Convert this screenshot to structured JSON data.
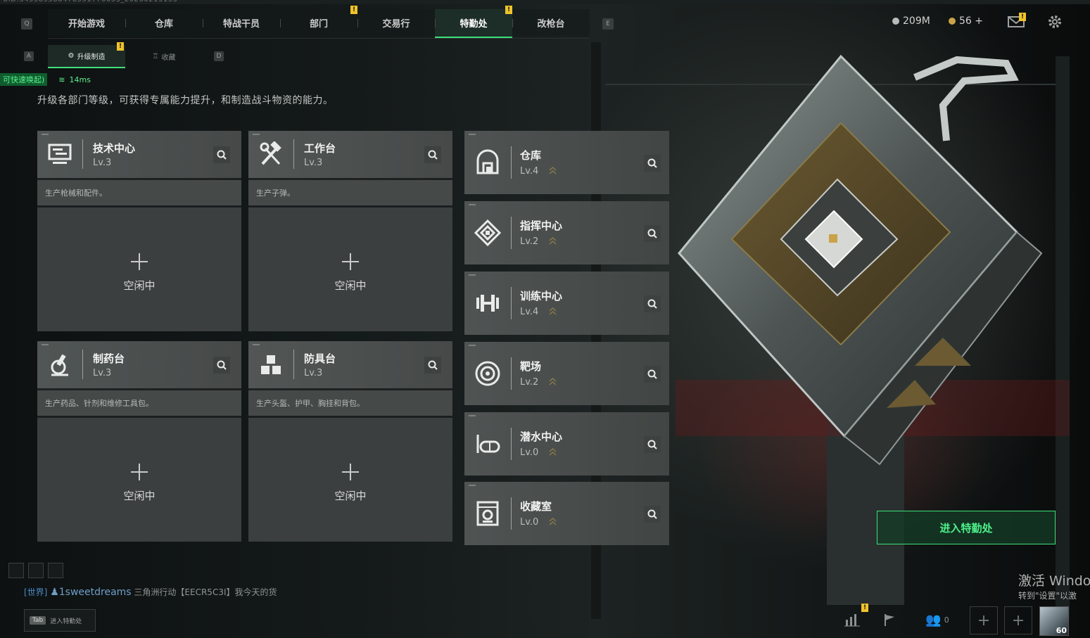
{
  "top_id": "UID:345589588478551770053_20260215155",
  "nav": {
    "left_key": "Q",
    "right_key": "E",
    "tabs": [
      {
        "label": "开始游戏",
        "badge": false
      },
      {
        "label": "仓库",
        "badge": false
      },
      {
        "label": "特战干员",
        "badge": false
      },
      {
        "label": "部门",
        "badge": true
      },
      {
        "label": "交易行",
        "badge": false
      },
      {
        "label": "特勤处",
        "badge": true,
        "active": true
      },
      {
        "label": "改枪台",
        "badge": false
      }
    ]
  },
  "currency": {
    "silver": "209M",
    "gold": "56 +"
  },
  "subnav": {
    "left_key": "A",
    "right_key": "D",
    "tabs": [
      {
        "label": "升级制造",
        "active": true,
        "badge": true
      },
      {
        "label": "收藏",
        "active": false
      }
    ]
  },
  "net": {
    "quick": "可快速唤起)",
    "ping": "14ms"
  },
  "description": "升级各部门等级，可获得专属能力提升，和制造战斗物资的能力。",
  "production": [
    {
      "name": "技术中心",
      "level": "Lv.3",
      "desc": "生产枪械和配件。",
      "status": "空闲中",
      "icon": "monitor-icon"
    },
    {
      "name": "工作台",
      "level": "Lv.3",
      "desc": "生产子弹。",
      "status": "空闲中",
      "icon": "hammer-wrench-icon"
    },
    {
      "name": "制药台",
      "level": "Lv.3",
      "desc": "生产药品、针剂和维修工具包。",
      "status": "空闲中",
      "icon": "microscope-icon"
    },
    {
      "name": "防具台",
      "level": "Lv.3",
      "desc": "生产头盔、护甲、胸挂和背包。",
      "status": "空闲中",
      "icon": "armor-icon"
    }
  ],
  "facilities": [
    {
      "name": "仓库",
      "level": "Lv.4",
      "icon": "warehouse-icon"
    },
    {
      "name": "指挥中心",
      "level": "Lv.2",
      "icon": "command-icon"
    },
    {
      "name": "训练中心",
      "level": "Lv.4",
      "icon": "dumbbell-icon"
    },
    {
      "name": "靶场",
      "level": "Lv.2",
      "icon": "target-icon"
    },
    {
      "name": "潜水中心",
      "level": "Lv.0",
      "icon": "diving-mask-icon"
    },
    {
      "name": "收藏室",
      "level": "Lv.0",
      "icon": "collection-icon"
    }
  ],
  "enter_button": "进入特勤处",
  "chat": {
    "channel": "[世界]",
    "user": "1sweetdreams",
    "message": "三角洲行动【EECR5C3I】我今天的货"
  },
  "tab_hint": {
    "key": "Tab",
    "label": "进入特勤处"
  },
  "windows": {
    "line1": "激活 Windo",
    "line2": "转到\"设置\"以激"
  },
  "bottom_bar": {
    "friends_count": "0",
    "avatar_level": "60"
  },
  "colors": {
    "accent": "#3ee07a",
    "badge": "#f0c32a",
    "panel": "#4a4e4d"
  }
}
